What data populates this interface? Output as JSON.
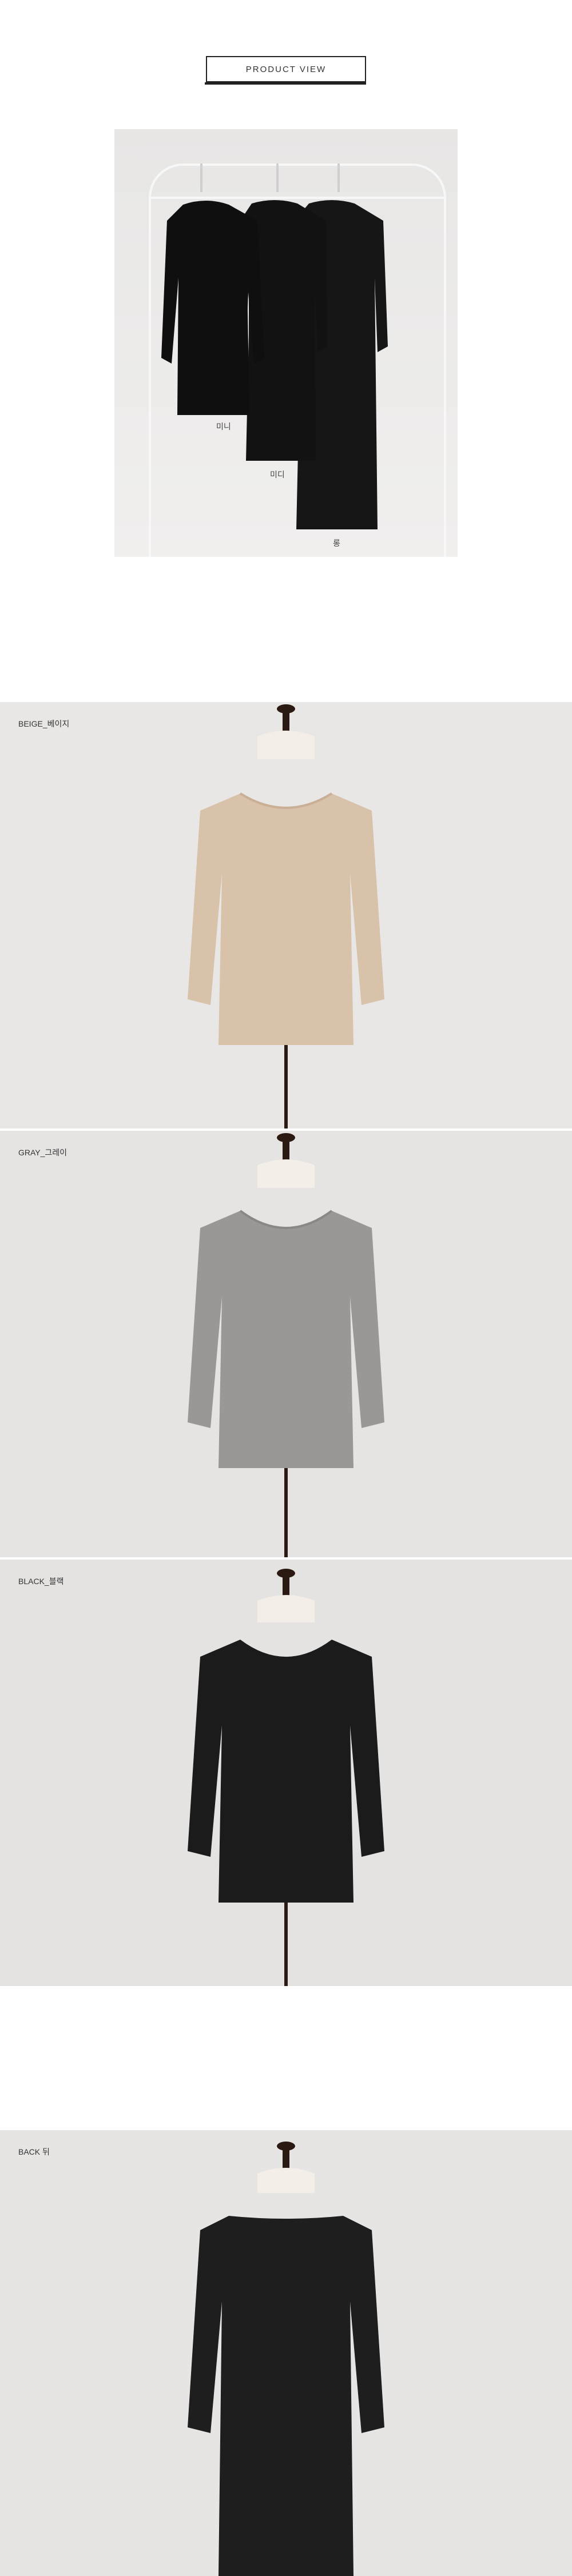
{
  "header": {
    "title": "PRODUCT VIEW"
  },
  "product_view": {
    "labels": [
      "미니",
      "미디",
      "롱"
    ]
  },
  "sections": [
    {
      "caption": "BEIGE_베이지",
      "color": "#d9c2aa"
    },
    {
      "caption": "GRAY_그레이",
      "color": "#9a9896"
    },
    {
      "caption": "BLACK_블랙",
      "color": "#1b1b1b"
    },
    {
      "caption": "BACK 뒤",
      "color": "#1e1e1e"
    }
  ]
}
